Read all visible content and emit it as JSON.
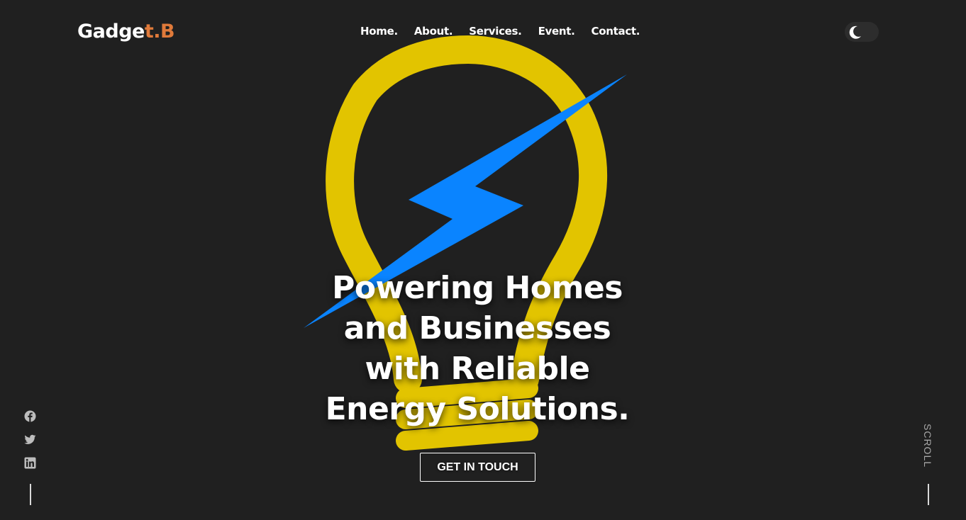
{
  "logo": {
    "part1": "Gadge",
    "part2": "t.B"
  },
  "nav": {
    "items": [
      {
        "label": "Home."
      },
      {
        "label": "About."
      },
      {
        "label": "Services."
      },
      {
        "label": "Event."
      },
      {
        "label": "Contact."
      }
    ]
  },
  "theme_toggle": {
    "icon": "moon-icon",
    "state": "dark"
  },
  "hero": {
    "headline_lines": [
      "Powering Homes",
      "and Businesses",
      "with Reliable",
      "Energy Solutions."
    ],
    "cta_label": "GET IN TOUCH"
  },
  "social": {
    "icons": [
      "facebook-icon",
      "twitter-icon",
      "linkedin-icon"
    ]
  },
  "scroll": {
    "label": "SCROLL"
  },
  "colors": {
    "background": "#202020",
    "bulb": "#e2c400",
    "bolt": "#0a84ff",
    "logo_accent": "#e07a3a",
    "text": "#ffffff"
  }
}
